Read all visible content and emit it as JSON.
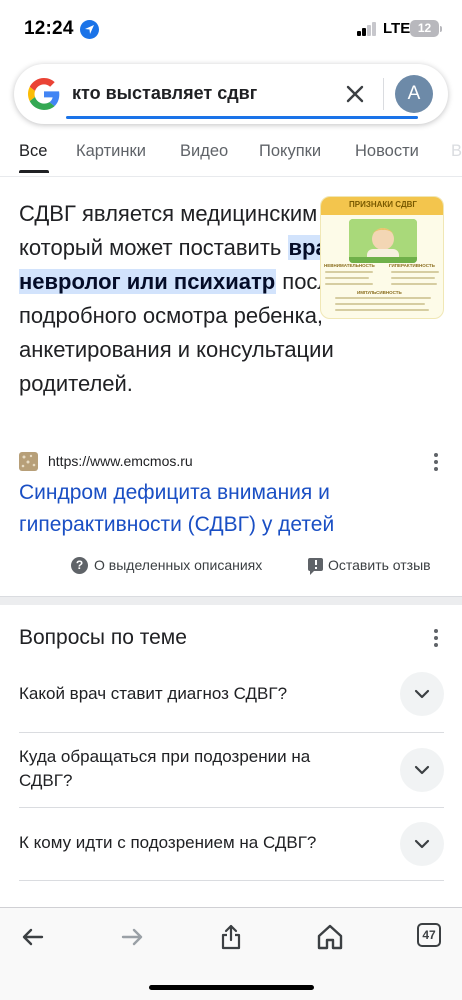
{
  "status_bar": {
    "time": "12:24",
    "network": "LTE",
    "battery": "12"
  },
  "search": {
    "query": "кто выставляет сдвг",
    "avatar_letter": "A"
  },
  "tabs": [
    "Все",
    "Картинки",
    "Видео",
    "Покупки",
    "Новости",
    "В"
  ],
  "snippet": {
    "text_before": "СДВГ является медицинским диагнозом, который может поставить ",
    "highlight": "врач-невролог или психиатр",
    "text_after": " после подробного осмотра ребенка, анкетирования и консультации родителей.",
    "thumbnail_title": "ПРИЗНАКИ СДВГ",
    "thumbnail_labels": [
      "НЕВНИМАТЕЛЬНОСТЬ",
      "ГИПЕРАКТИВНОСТЬ",
      "ИМПУЛЬСИВНОСТЬ"
    ]
  },
  "source": {
    "url": "https://www.emcmos.ru",
    "title": "Синдром дефицита внимания и гиперактивности (СДВГ) у детей"
  },
  "feedback": {
    "about_label": "О выделенных описаниях",
    "feedback_label": "Оставить отзыв"
  },
  "related": {
    "title": "Вопросы по теме",
    "questions": [
      "Какой врач ставит диагноз СДВГ?",
      "Куда обращаться при подозрении на СДВГ?",
      "К кому идти с подозрением на СДВГ?"
    ]
  },
  "bottom_bar": {
    "tab_count": "47"
  },
  "colors": {
    "accent": "#1a73e8",
    "link": "#1a4fc4",
    "highlight_bg": "#d2e3fc"
  }
}
